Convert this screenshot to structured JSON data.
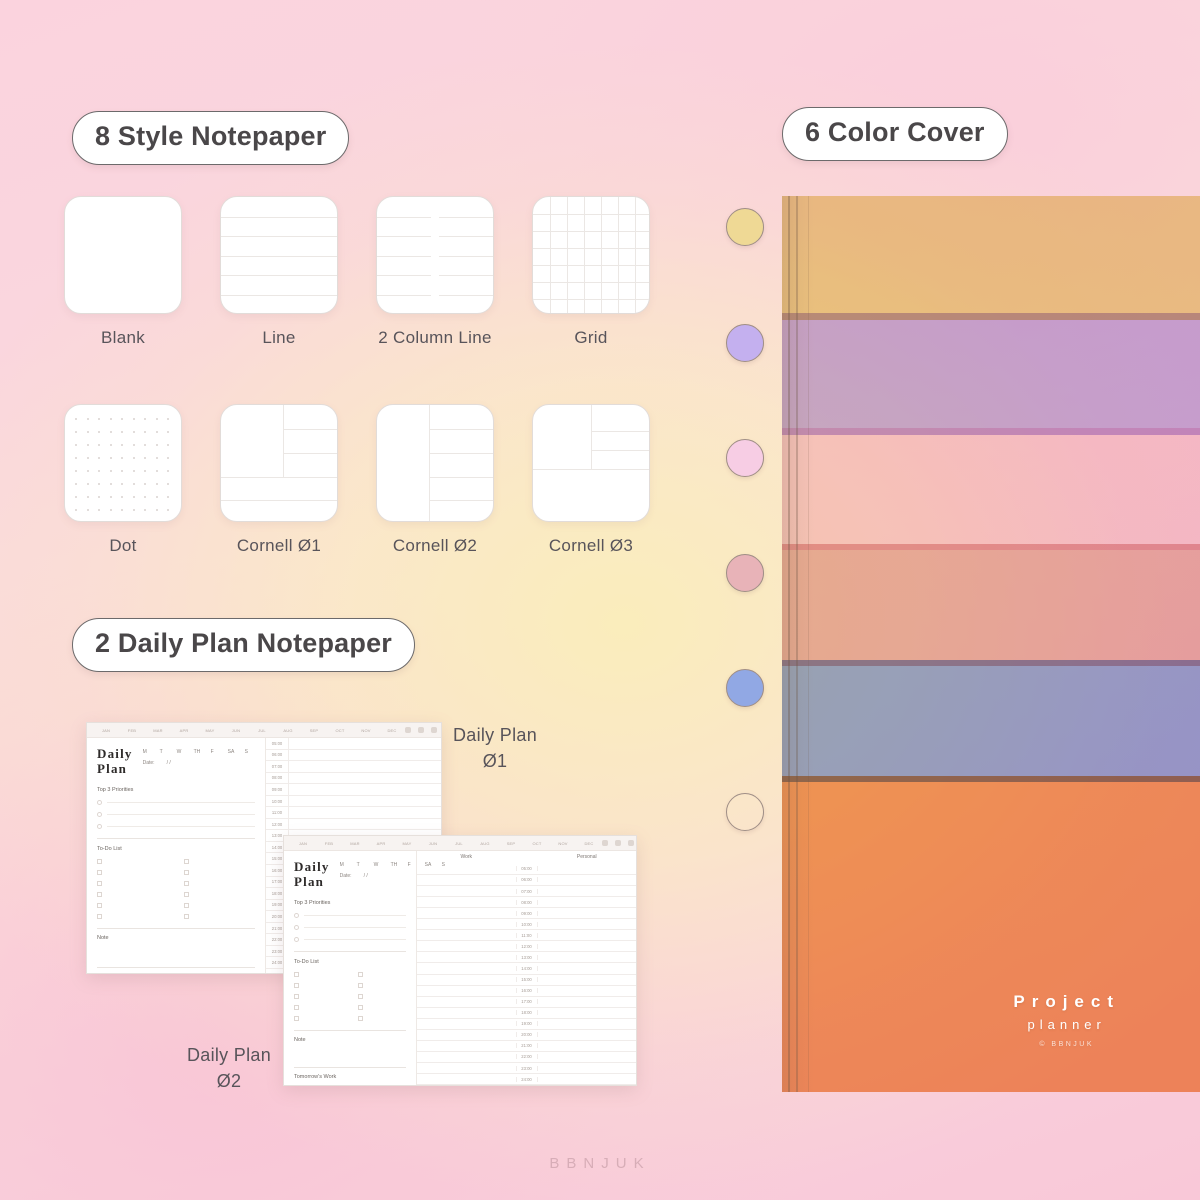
{
  "headings": {
    "styles": "8 Style Notepaper",
    "daily": "2 Daily Plan Notepaper",
    "cover": "6 Color Cover"
  },
  "note_styles": [
    {
      "label": "Blank",
      "kind": "blank"
    },
    {
      "label": "Line",
      "kind": "line"
    },
    {
      "label": "2 Column Line",
      "kind": "two-column-line"
    },
    {
      "label": "Grid",
      "kind": "grid"
    },
    {
      "label": "Dot",
      "kind": "dot"
    },
    {
      "label": "Cornell Ø1",
      "kind": "cornell-01"
    },
    {
      "label": "Cornell Ø2",
      "kind": "cornell-02"
    },
    {
      "label": "Cornell Ø3",
      "kind": "cornell-03"
    }
  ],
  "cover": {
    "brand_line1": "Project",
    "brand_line2": "planner",
    "brand_line3": "© BBNJUK",
    "colors": [
      {
        "name": "yellow",
        "swatch": "#efd995",
        "band": "#edd98f"
      },
      {
        "name": "purple",
        "swatch": "#c4b0ef",
        "band": "#c6b2f0"
      },
      {
        "name": "pink",
        "swatch": "#f7cde4",
        "band": "#fad3e6"
      },
      {
        "name": "rose",
        "swatch": "#e8b3b8",
        "band": "#eab4b4"
      },
      {
        "name": "blue",
        "swatch": "#91a8e4",
        "band": "#93aae6"
      },
      {
        "name": "orange",
        "swatch": "#f4a濃",
        "band": "#f3a368"
      }
    ]
  },
  "daily_plans": [
    {
      "caption_line1": "Daily Plan",
      "caption_line2": "Ø1"
    },
    {
      "caption_line1": "Daily Plan",
      "caption_line2": "Ø2"
    }
  ],
  "mockup": {
    "months": [
      "JAN",
      "FEB",
      "MAR",
      "APR",
      "MAY",
      "JUN",
      "JUL",
      "AUG",
      "SEP",
      "OCT",
      "NOV",
      "DEC"
    ],
    "title": "Daily Plan",
    "weekdays": [
      "M",
      "T",
      "W",
      "TH",
      "F",
      "SA",
      "S"
    ],
    "date_label": "Date:",
    "date_slashes": "/      /",
    "priorities_label": "Top 3 Priorities",
    "todo_label": "To-Do List",
    "note_label": "Note",
    "tomorrow_label": "Tomorrow's Work",
    "times": [
      "05:00",
      "06:00",
      "07:00",
      "08:00",
      "09:00",
      "10:00",
      "11:00",
      "12:00",
      "13:00",
      "14:00",
      "15:00",
      "16:00",
      "17:00",
      "18:00",
      "19:00",
      "20:00",
      "21:00",
      "22:00",
      "23:00",
      "24:00"
    ],
    "columns": [
      "Work",
      "Personal"
    ],
    "toolbar_icons": [
      "undo-icon",
      "copy-icon",
      "lasso-icon",
      "heart-icon",
      "bookmark-icon",
      "pen-icon"
    ]
  },
  "footer": {
    "watermark": "BBNJUK"
  }
}
